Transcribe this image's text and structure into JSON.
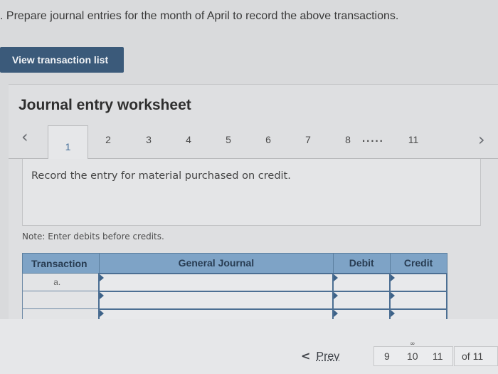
{
  "instruction": ". Prepare journal entries for the month of April to record the above transactions.",
  "view_button": "View transaction list",
  "worksheet": {
    "title": "Journal entry worksheet",
    "prev_arrow": "‹",
    "next_arrow": "›",
    "tabs": [
      "1",
      "2",
      "3",
      "4",
      "5",
      "6",
      "7",
      "8",
      "11"
    ],
    "ellipsis": ".....",
    "entry_text": "Record the entry for material purchased on credit.",
    "note": "Note: Enter debits before credits."
  },
  "table": {
    "headers": [
      "Transaction",
      "General Journal",
      "Debit",
      "Credit"
    ],
    "rows": [
      {
        "transaction": "a."
      },
      {
        "transaction": ""
      },
      {
        "transaction": ""
      }
    ]
  },
  "pagination": {
    "prev_label": "Prev",
    "pages": [
      "9",
      "10",
      "11"
    ],
    "of_label": "of 11",
    "link_icon": "link-icon"
  }
}
